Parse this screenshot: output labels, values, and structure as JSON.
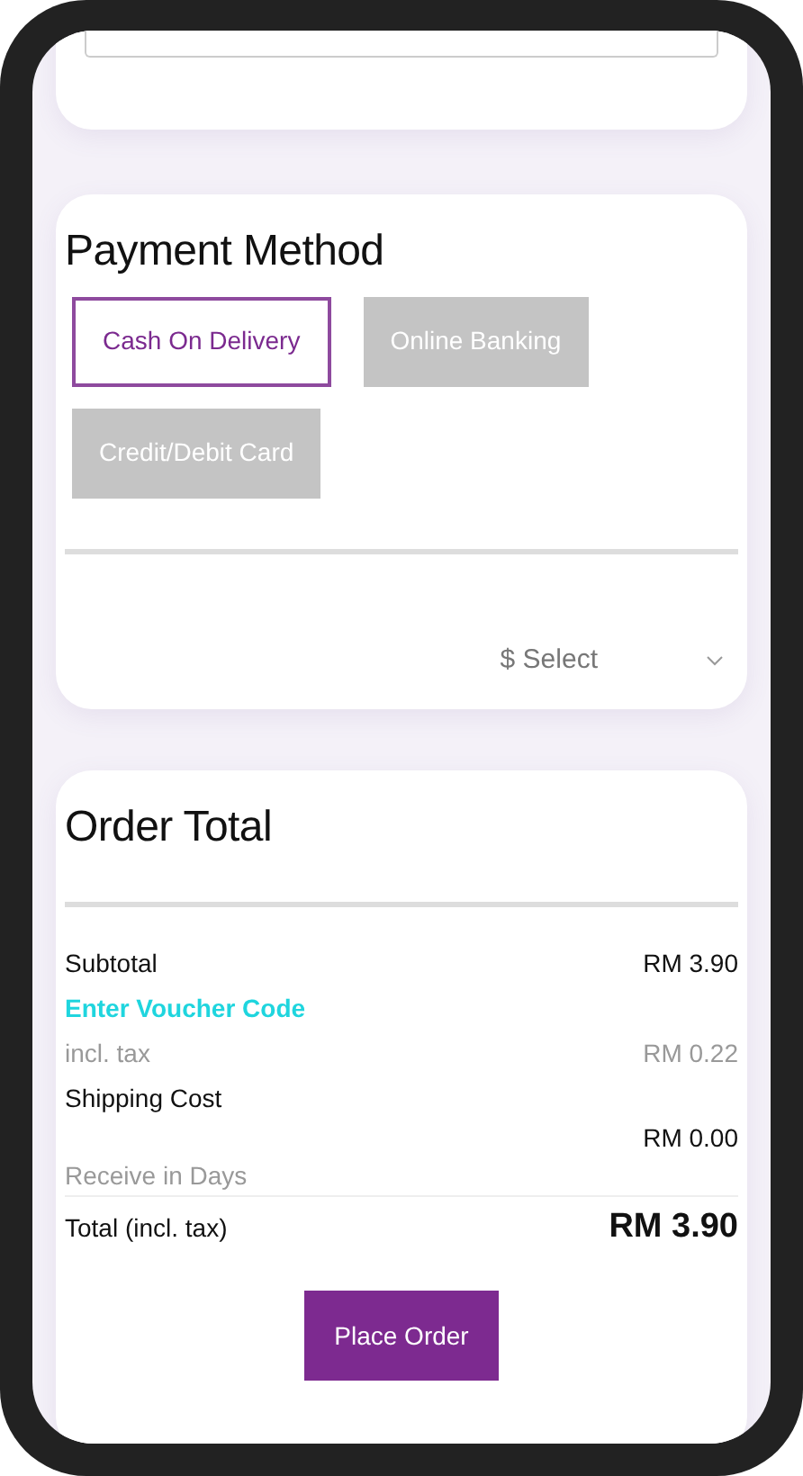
{
  "payment_method": {
    "title": "Payment Method",
    "options": [
      {
        "label": "Cash On Delivery",
        "selected": true
      },
      {
        "label": "Online Banking",
        "selected": false
      },
      {
        "label": "Credit/Debit Card",
        "selected": false
      }
    ],
    "select": {
      "placeholder": "$ Select"
    }
  },
  "order_total": {
    "title": "Order Total",
    "rows": [
      {
        "kind": "amount",
        "label": "Subtotal",
        "value": "RM 3.90"
      },
      {
        "kind": "link",
        "label": "Enter Voucher Code"
      },
      {
        "kind": "muted",
        "label": "incl. tax",
        "value": "RM 0.22"
      },
      {
        "kind": "label",
        "label": "Shipping Cost"
      },
      {
        "kind": "value",
        "value": "RM 0.00"
      },
      {
        "kind": "note",
        "label": "Receive in Days"
      },
      {
        "kind": "total",
        "label": "Total (incl. tax)",
        "value": "RM 3.90"
      }
    ],
    "button": "Place Order"
  }
}
